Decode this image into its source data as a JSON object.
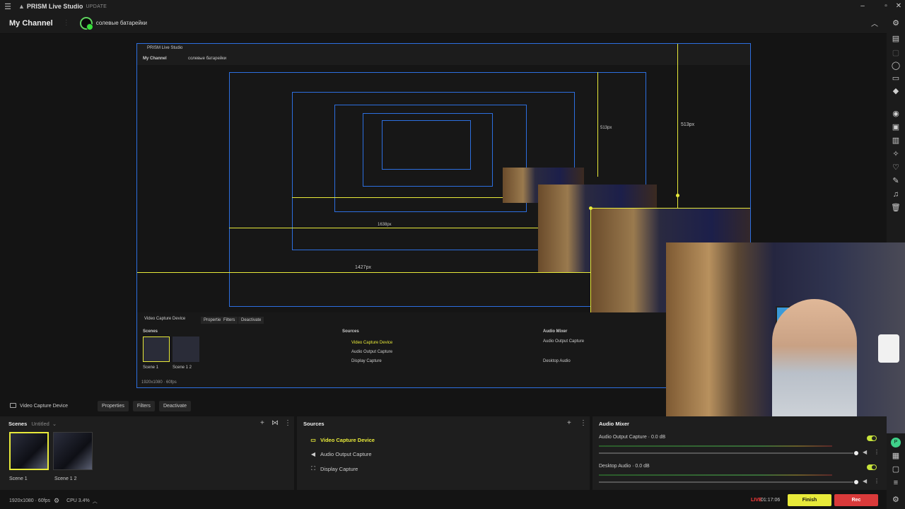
{
  "titlebar": {
    "app_name": "PRISM Live Studio",
    "update_label": "UPDATE"
  },
  "channelbar": {
    "channel_name": "My Channel",
    "channel_label": "солевые батарейки"
  },
  "preview": {
    "size_labels": [
      "513px",
      "513px",
      "1427px",
      "1638px",
      "513px"
    ]
  },
  "source_toolbar": {
    "device": "Video Capture Device",
    "buttons": [
      "Properties",
      "Filters",
      "Deactivate"
    ]
  },
  "scenes": {
    "title": "Scenes",
    "collection": "Untitled",
    "items": [
      {
        "label": "Scene 1"
      },
      {
        "label": "Scene 1 2"
      }
    ]
  },
  "sources": {
    "title": "Sources",
    "items": [
      {
        "label": "Video Capture Device",
        "icon": "camera-icon"
      },
      {
        "label": "Audio Output Capture",
        "icon": "speaker-icon"
      },
      {
        "label": "Display Capture",
        "icon": "display-icon"
      }
    ]
  },
  "mixer": {
    "title": "Audio Mixer",
    "channels": [
      {
        "label": "Audio Output Capture",
        "level": "0.0 dB"
      },
      {
        "label": "Desktop Audio",
        "level": "0.0 dB"
      }
    ]
  },
  "status": {
    "resolution": "1920x1080 · 60fps",
    "cpu": "CPU 3.4%",
    "live_label": "LIVE",
    "live_time": "01:17:06",
    "finish_label": "Finish",
    "rec_label": "Rec"
  },
  "colors": {
    "accent": "#e8ea3a",
    "select_blue": "#2d6fe0",
    "live_red": "#ff3b3b"
  }
}
